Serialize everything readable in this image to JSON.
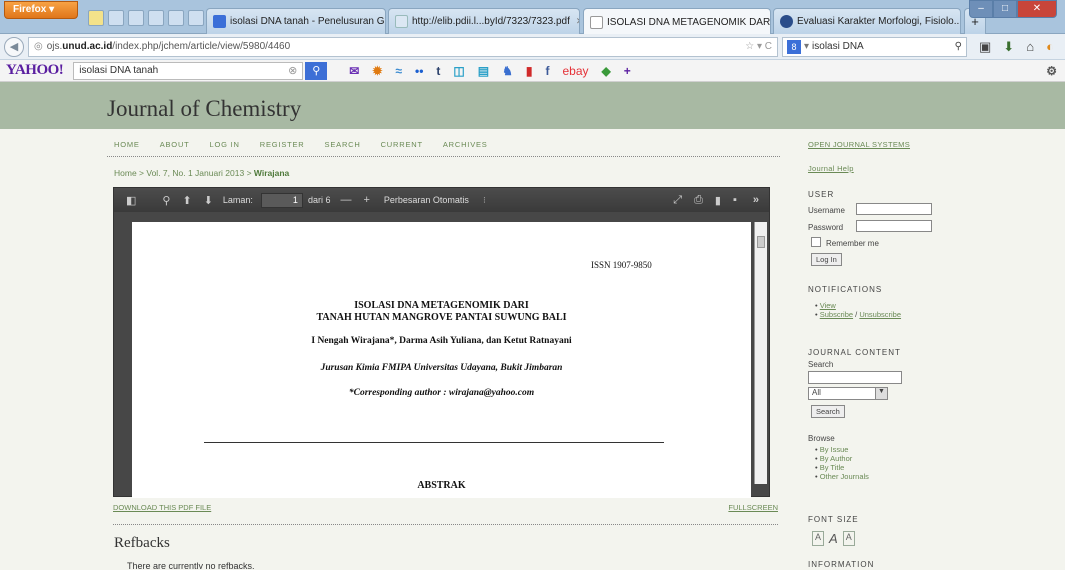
{
  "browser": {
    "menu_button": "Firefox ▾",
    "tabs": [
      {
        "label": "isolasi DNA tanah - Penelusuran G...",
        "active": false
      },
      {
        "label": "http://elib.pdii.l...byId/7323/7323.pdf",
        "active": false
      },
      {
        "label": "ISOLASI DNA METAGENOMIK DARI...",
        "active": true
      },
      {
        "label": "Evaluasi Karakter Morfologi, Fisiolo...",
        "active": false
      }
    ],
    "new_tab": "+",
    "url_prefix": "ojs.",
    "url_domain": "unud.ac.id",
    "url_path": "/index.php/jchem/article/view/5980/4460",
    "search_value": "isolasi DNA",
    "window_buttons": [
      "–",
      "□",
      "✕"
    ]
  },
  "yahoo": {
    "logo": "YAHOO!",
    "search_value": "isolasi DNA tanah"
  },
  "journal": {
    "title": "Journal of Chemistry",
    "menu": [
      "HOME",
      "ABOUT",
      "LOG IN",
      "REGISTER",
      "SEARCH",
      "CURRENT",
      "ARCHIVES"
    ],
    "breadcrumb_home": "Home",
    "breadcrumb_issue": "Vol. 7, No. 1 Januari 2013",
    "breadcrumb_current": "Wirajana",
    "download_link": "DOWNLOAD THIS PDF FILE",
    "fullscreen_link": "FULLSCREEN",
    "refbacks_heading": "Refbacks",
    "refbacks_text": "There are currently no refbacks."
  },
  "pdf_viewer": {
    "page_label": "Laman:",
    "page_value": "1",
    "page_total": "dari 6",
    "zoom_value": "Perbesaran Otomatis",
    "paper": {
      "issn": "ISSN 1907-9850",
      "title_line1": "ISOLASI DNA METAGENOMIK DARI",
      "title_line2": "TANAH HUTAN MANGROVE PANTAI SUWUNG BALI",
      "authors": "I Nengah Wirajana*, Darma Asih Yuliana, dan Ketut Ratnayani",
      "affiliation": "Jurusan Kimia FMIPA Universitas Udayana, Bukit Jimbaran",
      "corresponding": "*Corresponding author : wirajana@yahoo.com",
      "abstract_heading": "ABSTRAK"
    }
  },
  "sidebar": {
    "ojs_link": "OPEN JOURNAL SYSTEMS",
    "help_link": "Journal Help",
    "user_heading": "USER",
    "username_label": "Username",
    "password_label": "Password",
    "remember_label": "Remember me",
    "login_button": "Log In",
    "notifications_heading": "NOTIFICATIONS",
    "notif_view": "View",
    "notif_subscribe": "Subscribe",
    "notif_sep": " / ",
    "notif_unsubscribe": "Unsubscribe",
    "content_heading": "JOURNAL CONTENT",
    "search_label": "Search",
    "scope_value": "All",
    "search_button": "Search",
    "browse_label": "Browse",
    "browse_items": [
      "By Issue",
      "By Author",
      "By Title",
      "Other Journals"
    ],
    "fontsize_heading": "FONT SIZE",
    "information_heading": "INFORMATION"
  }
}
